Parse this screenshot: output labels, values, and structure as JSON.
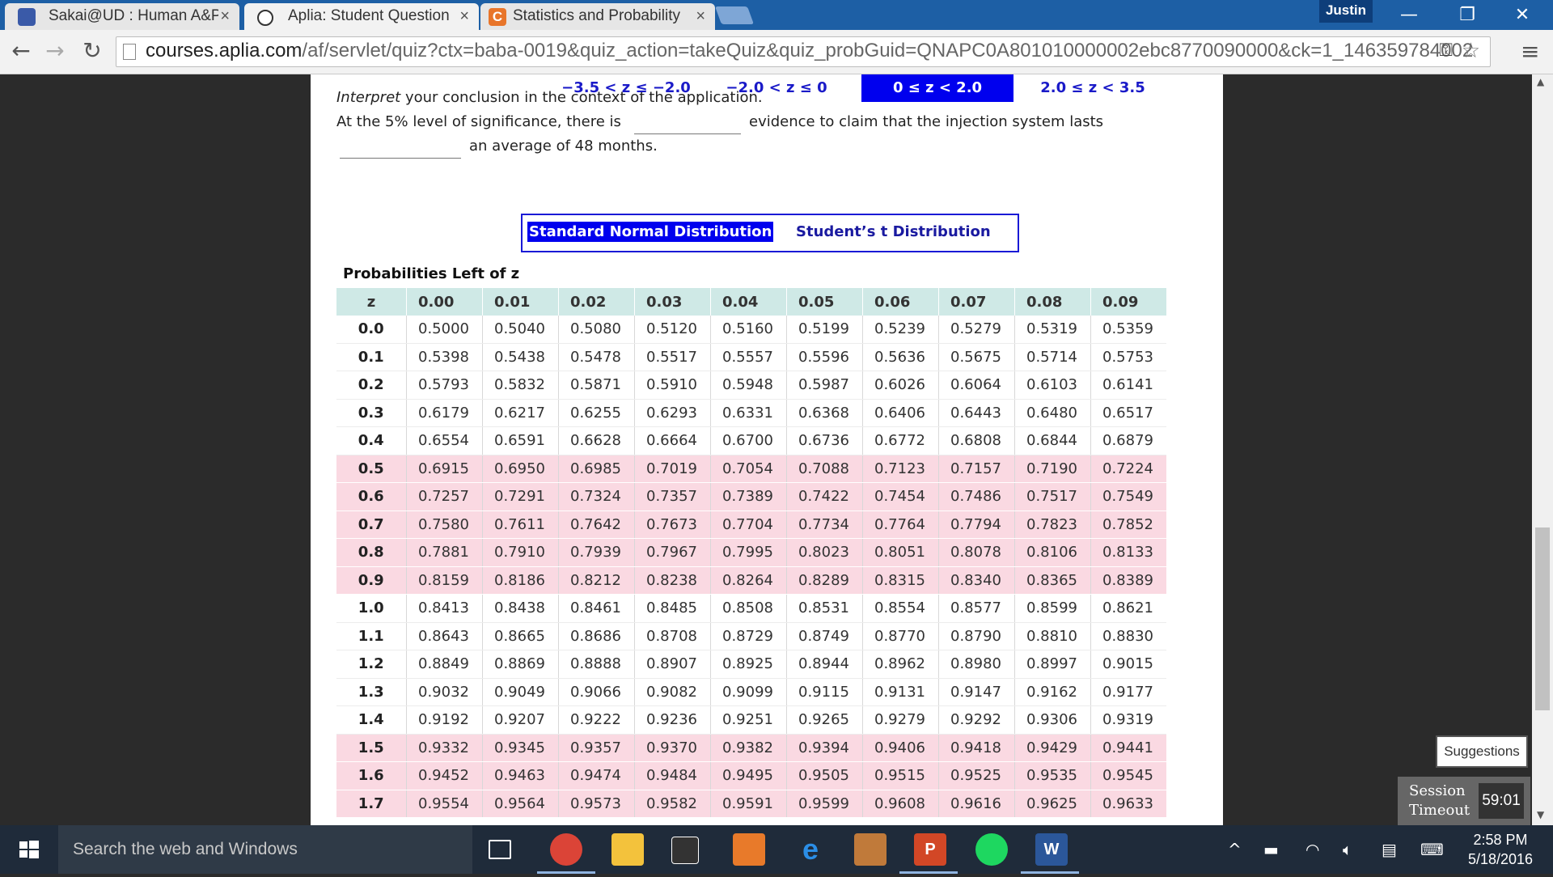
{
  "browser": {
    "tabs": [
      {
        "label": "Sakai@UD : Human A&P (",
        "icon": "sakai-icon",
        "active": false
      },
      {
        "label": "Aplia: Student Question",
        "icon": "aplia-icon",
        "active": true
      },
      {
        "label": "Statistics and Probability c",
        "icon": "chegg-icon",
        "active": false
      }
    ],
    "tab_close": "×",
    "profile_name": "Justin",
    "url_host": "courses.aplia.com",
    "url_rest": "/af/servlet/quiz?ctx=baba-0019&quiz_action=takeQuiz&quiz_probGuid=QNAPC0A801010000002ebc8770090000&ck=1_146359784002"
  },
  "question": {
    "interpret_word": "Interpret",
    "interpret_rest": " your conclusion in the context of the application.",
    "line2_a": "At the 5% level of significance, there is",
    "line2_b": "evidence to claim that the injection system lasts",
    "line3": "an average of 48 months."
  },
  "table_switcher": {
    "normal": "Standard Normal Distribution",
    "student": "Student’s t Distribution"
  },
  "range_header": {
    "label": "Probabilities Left of z",
    "ranges": [
      "−3.5 < z ≤ −2.0",
      "−2.0 < z ≤ 0",
      "0 ≤ z < 2.0",
      "2.0 ≤ z < 3.5"
    ],
    "selected_index": 2
  },
  "ztable": {
    "columns": [
      "z",
      "0.00",
      "0.01",
      "0.02",
      "0.03",
      "0.04",
      "0.05",
      "0.06",
      "0.07",
      "0.08",
      "0.09"
    ],
    "rows": [
      {
        "z": "0.0",
        "v": [
          "0.5000",
          "0.5040",
          "0.5080",
          "0.5120",
          "0.5160",
          "0.5199",
          "0.5239",
          "0.5279",
          "0.5319",
          "0.5359"
        ]
      },
      {
        "z": "0.1",
        "v": [
          "0.5398",
          "0.5438",
          "0.5478",
          "0.5517",
          "0.5557",
          "0.5596",
          "0.5636",
          "0.5675",
          "0.5714",
          "0.5753"
        ]
      },
      {
        "z": "0.2",
        "v": [
          "0.5793",
          "0.5832",
          "0.5871",
          "0.5910",
          "0.5948",
          "0.5987",
          "0.6026",
          "0.6064",
          "0.6103",
          "0.6141"
        ]
      },
      {
        "z": "0.3",
        "v": [
          "0.6179",
          "0.6217",
          "0.6255",
          "0.6293",
          "0.6331",
          "0.6368",
          "0.6406",
          "0.6443",
          "0.6480",
          "0.6517"
        ]
      },
      {
        "z": "0.4",
        "v": [
          "0.6554",
          "0.6591",
          "0.6628",
          "0.6664",
          "0.6700",
          "0.6736",
          "0.6772",
          "0.6808",
          "0.6844",
          "0.6879"
        ]
      },
      {
        "z": "0.5",
        "v": [
          "0.6915",
          "0.6950",
          "0.6985",
          "0.7019",
          "0.7054",
          "0.7088",
          "0.7123",
          "0.7157",
          "0.7190",
          "0.7224"
        ]
      },
      {
        "z": "0.6",
        "v": [
          "0.7257",
          "0.7291",
          "0.7324",
          "0.7357",
          "0.7389",
          "0.7422",
          "0.7454",
          "0.7486",
          "0.7517",
          "0.7549"
        ]
      },
      {
        "z": "0.7",
        "v": [
          "0.7580",
          "0.7611",
          "0.7642",
          "0.7673",
          "0.7704",
          "0.7734",
          "0.7764",
          "0.7794",
          "0.7823",
          "0.7852"
        ]
      },
      {
        "z": "0.8",
        "v": [
          "0.7881",
          "0.7910",
          "0.7939",
          "0.7967",
          "0.7995",
          "0.8023",
          "0.8051",
          "0.8078",
          "0.8106",
          "0.8133"
        ]
      },
      {
        "z": "0.9",
        "v": [
          "0.8159",
          "0.8186",
          "0.8212",
          "0.8238",
          "0.8264",
          "0.8289",
          "0.8315",
          "0.8340",
          "0.8365",
          "0.8389"
        ]
      },
      {
        "z": "1.0",
        "v": [
          "0.8413",
          "0.8438",
          "0.8461",
          "0.8485",
          "0.8508",
          "0.8531",
          "0.8554",
          "0.8577",
          "0.8599",
          "0.8621"
        ]
      },
      {
        "z": "1.1",
        "v": [
          "0.8643",
          "0.8665",
          "0.8686",
          "0.8708",
          "0.8729",
          "0.8749",
          "0.8770",
          "0.8790",
          "0.8810",
          "0.8830"
        ]
      },
      {
        "z": "1.2",
        "v": [
          "0.8849",
          "0.8869",
          "0.8888",
          "0.8907",
          "0.8925",
          "0.8944",
          "0.8962",
          "0.8980",
          "0.8997",
          "0.9015"
        ]
      },
      {
        "z": "1.3",
        "v": [
          "0.9032",
          "0.9049",
          "0.9066",
          "0.9082",
          "0.9099",
          "0.9115",
          "0.9131",
          "0.9147",
          "0.9162",
          "0.9177"
        ]
      },
      {
        "z": "1.4",
        "v": [
          "0.9192",
          "0.9207",
          "0.9222",
          "0.9236",
          "0.9251",
          "0.9265",
          "0.9279",
          "0.9292",
          "0.9306",
          "0.9319"
        ]
      },
      {
        "z": "1.5",
        "v": [
          "0.9332",
          "0.9345",
          "0.9357",
          "0.9370",
          "0.9382",
          "0.9394",
          "0.9406",
          "0.9418",
          "0.9429",
          "0.9441"
        ]
      },
      {
        "z": "1.6",
        "v": [
          "0.9452",
          "0.9463",
          "0.9474",
          "0.9484",
          "0.9495",
          "0.9505",
          "0.9515",
          "0.9525",
          "0.9535",
          "0.9545"
        ]
      },
      {
        "z": "1.7",
        "v": [
          "0.9554",
          "0.9564",
          "0.9573",
          "0.9582",
          "0.9591",
          "0.9599",
          "0.9608",
          "0.9616",
          "0.9625",
          "0.9633"
        ]
      }
    ]
  },
  "widgets": {
    "suggestions": "Suggestions",
    "session_label_1": "Session",
    "session_label_2": "Timeout",
    "session_time": "59:01"
  },
  "taskbar": {
    "search_placeholder": "Search the web and Windows",
    "clock_time": "2:58 PM",
    "clock_date": "5/18/2016"
  },
  "colors": {
    "titlebar": "#1d5fa5",
    "selected_blue": "#0000ee",
    "header_teal": "#cfe9e6",
    "row_pink": "#fad9e2"
  }
}
